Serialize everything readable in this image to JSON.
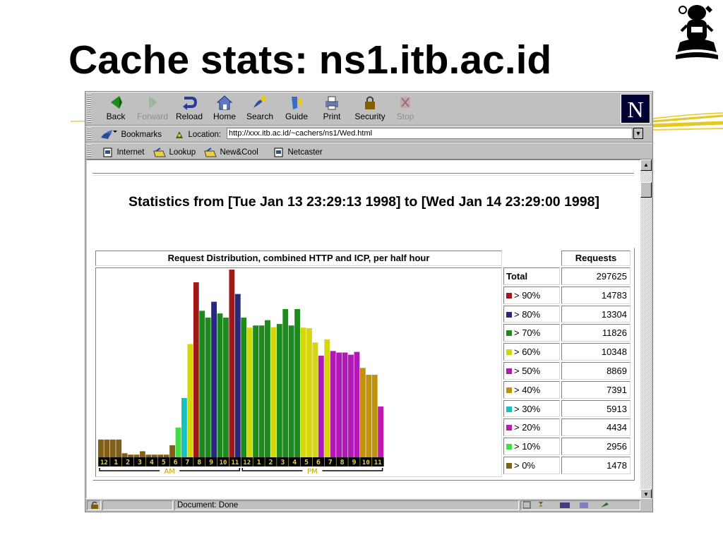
{
  "slide": {
    "title": "Cache stats: ns1.itb.ac.id"
  },
  "toolbar": {
    "buttons": [
      {
        "label": "Back",
        "icon": "back-arrow-icon",
        "enabled": true
      },
      {
        "label": "Forward",
        "icon": "forward-arrow-icon",
        "enabled": false
      },
      {
        "label": "Reload",
        "icon": "reload-icon",
        "enabled": true
      },
      {
        "label": "Home",
        "icon": "home-icon",
        "enabled": true
      },
      {
        "label": "Search",
        "icon": "search-icon",
        "enabled": true
      },
      {
        "label": "Guide",
        "icon": "guide-icon",
        "enabled": true
      },
      {
        "label": "Print",
        "icon": "print-icon",
        "enabled": true
      },
      {
        "label": "Security",
        "icon": "lock-icon",
        "enabled": true
      },
      {
        "label": "Stop",
        "icon": "stop-icon",
        "enabled": false
      }
    ],
    "brand": "N"
  },
  "location": {
    "bookmarks_label": "Bookmarks",
    "location_label": "Location:",
    "url": "http://xxx.itb.ac.id/~cachers/ns1/Wed.html"
  },
  "personal": {
    "items": [
      {
        "label": "Internet",
        "icon": "page-icon"
      },
      {
        "label": "Lookup",
        "icon": "folder-icon"
      },
      {
        "label": "New&Cool",
        "icon": "folder-icon"
      },
      {
        "label": "Netcaster",
        "icon": "page-icon"
      }
    ]
  },
  "page": {
    "heading": "Statistics from [Tue Jan 13 23:29:13 1998] to [Wed Jan 14 23:29:00 1998]",
    "chart_title": "Request Distribution, combined HTTP and ICP, per half hour",
    "requests_header": "Requests",
    "total_label": "Total",
    "total_value": "297625",
    "legend": [
      {
        "label": "> 90%",
        "value": "14783",
        "color": "#a01818"
      },
      {
        "label": "> 80%",
        "value": "13304",
        "color": "#28287c"
      },
      {
        "label": "> 70%",
        "value": "11826",
        "color": "#1e8a1e"
      },
      {
        "label": "> 60%",
        "value": "10348",
        "color": "#d6d60e"
      },
      {
        "label": "> 50%",
        "value": "8869",
        "color": "#b018b8"
      },
      {
        "label": "> 40%",
        "value": "7391",
        "color": "#c0920c"
      },
      {
        "label": "> 30%",
        "value": "5913",
        "color": "#18c0c0"
      },
      {
        "label": "> 20%",
        "value": "4434",
        "color": "#c018b0"
      },
      {
        "label": "> 10%",
        "value": "2956",
        "color": "#40e040"
      },
      {
        "label": "> 0%",
        "value": "1478",
        "color": "#806018"
      }
    ]
  },
  "chart_data": {
    "type": "bar",
    "title": "Request Distribution, combined HTTP and ICP, per half hour",
    "x_ticks": [
      "12",
      "1",
      "2",
      "3",
      "4",
      "5",
      "6",
      "7",
      "8",
      "9",
      "10",
      "11",
      "12",
      "1",
      "2",
      "3",
      "4",
      "5",
      "6",
      "7",
      "8",
      "9",
      "10",
      "11"
    ],
    "period_labels": [
      "AM",
      "PM"
    ],
    "max_value": 14783,
    "values": [
      1400,
      1400,
      1400,
      1400,
      320,
      210,
      210,
      480,
      210,
      210,
      210,
      210,
      950,
      2340,
      4670,
      8920,
      13780,
      11540,
      11000,
      12250,
      11330,
      11000,
      14780,
      12860,
      11000,
      10210,
      10380,
      10380,
      10800,
      10250,
      10500,
      11670,
      10380,
      11670,
      10210,
      10170,
      9040,
      8000,
      9290,
      8370,
      8250,
      8250,
      8080,
      8300,
      7040,
      6500,
      6500,
      4000
    ]
  },
  "status": {
    "text": "Document: Done"
  }
}
